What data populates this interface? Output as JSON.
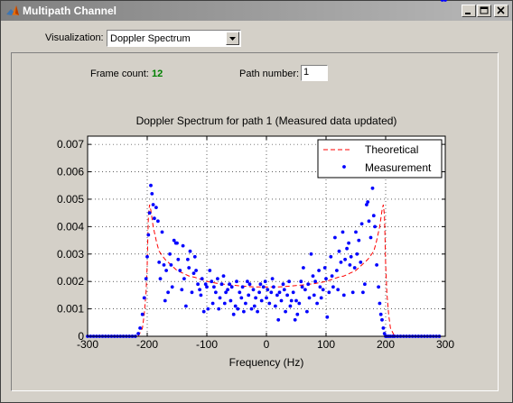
{
  "window": {
    "title": "Multipath Channel",
    "buttons": [
      "minimize",
      "maximize",
      "close"
    ]
  },
  "controls": {
    "visualization_label": "Visualization:",
    "visualization_value": "Doppler Spectrum",
    "frame_count_label": "Frame count:",
    "frame_count_value": "12",
    "path_number_label": "Path number:",
    "path_number_value": "1"
  },
  "colors": {
    "theoretical": "#ff0000",
    "measurement": "#0000ff",
    "frame_count": "#008000"
  },
  "chart_data": {
    "type": "scatter",
    "title": "Doppler Spectrum for path 1 (Measured data updated)",
    "xlabel": "Frequency (Hz)",
    "ylabel": "",
    "xlim": [
      -300,
      300
    ],
    "ylim": [
      0,
      0.0073
    ],
    "xticks": [
      "-300",
      "-200",
      "-100",
      "0",
      "100",
      "200",
      "300"
    ],
    "yticks": [
      "0",
      "0.001",
      "0.002",
      "0.003",
      "0.004",
      "0.005",
      "0.006",
      "0.007"
    ],
    "grid": true,
    "legend_position": "top-right",
    "legend": [
      "Theoretical",
      "Measurement"
    ],
    "fd": 200,
    "theoretical": {
      "name": "Theoretical",
      "style": "dashed line",
      "x": [
        -300,
        -215,
        -208,
        -205,
        -202,
        -200,
        -199,
        -198,
        -196,
        -194,
        -192,
        -190,
        -187,
        -184,
        -180,
        -170,
        -160,
        -150,
        -140,
        -130,
        -120,
        -100,
        -80,
        -60,
        -40,
        -20,
        0,
        20,
        40,
        60,
        80,
        100,
        120,
        130,
        140,
        150,
        160,
        170,
        180,
        184,
        187,
        190,
        192,
        194,
        196,
        198,
        199,
        200,
        202,
        205,
        208,
        215,
        300
      ],
      "y": [
        0,
        0,
        0.0003,
        0.0008,
        0.0016,
        0.0026,
        0.0036,
        0.0044,
        0.0048,
        0.0046,
        0.0043,
        0.004,
        0.0037,
        0.0034,
        0.0031,
        0.0028,
        0.0026,
        0.0024,
        0.0023,
        0.0022,
        0.00215,
        0.002,
        0.00192,
        0.00187,
        0.00183,
        0.0018,
        0.0018,
        0.0018,
        0.00183,
        0.00187,
        0.00192,
        0.002,
        0.00215,
        0.0022,
        0.0023,
        0.0024,
        0.0026,
        0.0028,
        0.0031,
        0.0034,
        0.0037,
        0.004,
        0.0043,
        0.0046,
        0.0048,
        0.0044,
        0.0036,
        0.0026,
        0.0016,
        0.0008,
        0.0003,
        0,
        0
      ]
    },
    "measurement": {
      "name": "Measurement",
      "style": "dot markers",
      "x": [
        -300,
        -295,
        -290,
        -285,
        -280,
        -275,
        -270,
        -265,
        -260,
        -255,
        -250,
        -245,
        -240,
        -235,
        -230,
        -225,
        -220,
        -215,
        -212,
        -208,
        -205,
        -202,
        -200,
        -198,
        -196,
        -194,
        -192,
        -190,
        -188,
        -185,
        -182,
        -180,
        -178,
        -175,
        -172,
        -170,
        -168,
        -165,
        -162,
        -160,
        -158,
        -155,
        -152,
        -150,
        -148,
        -145,
        -142,
        -140,
        -138,
        -135,
        -132,
        -130,
        -128,
        -125,
        -122,
        -120,
        -118,
        -115,
        -112,
        -110,
        -108,
        -105,
        -102,
        -100,
        -98,
        -95,
        -92,
        -90,
        -88,
        -85,
        -82,
        -80,
        -78,
        -75,
        -72,
        -70,
        -68,
        -65,
        -62,
        -60,
        -58,
        -55,
        -52,
        -50,
        -48,
        -45,
        -42,
        -40,
        -38,
        -35,
        -32,
        -30,
        -28,
        -25,
        -22,
        -20,
        -18,
        -15,
        -12,
        -10,
        -8,
        -5,
        -2,
        0,
        2,
        5,
        8,
        10,
        12,
        15,
        18,
        20,
        22,
        25,
        28,
        30,
        32,
        35,
        38,
        40,
        42,
        45,
        48,
        50,
        52,
        55,
        58,
        60,
        62,
        65,
        68,
        70,
        72,
        75,
        78,
        80,
        82,
        85,
        88,
        90,
        92,
        95,
        98,
        100,
        102,
        105,
        108,
        110,
        112,
        115,
        118,
        120,
        122,
        125,
        128,
        130,
        132,
        135,
        138,
        140,
        142,
        145,
        148,
        150,
        152,
        155,
        158,
        160,
        162,
        165,
        168,
        170,
        172,
        175,
        178,
        180,
        182,
        185,
        188,
        190,
        192,
        194,
        196,
        198,
        200,
        202,
        205,
        208,
        212,
        215,
        220,
        225,
        230,
        235,
        240,
        245,
        250,
        255,
        260,
        265,
        270,
        275,
        280,
        285,
        290,
        295,
        300
      ],
      "y": [
        0,
        0,
        0,
        0,
        0,
        0,
        0,
        0,
        0,
        0,
        0,
        0,
        0,
        0,
        0,
        0,
        0,
        0.0001,
        0.0003,
        0.0008,
        0.0014,
        0.0021,
        0.0029,
        0.0037,
        0.0045,
        0.0055,
        0.0052,
        0.0048,
        0.0043,
        0.0047,
        0.0042,
        0.0027,
        0.0021,
        0.0038,
        0.0026,
        0.0013,
        0.0024,
        0.0016,
        0.003,
        0.0026,
        0.0018,
        0.0035,
        0.0034,
        0.0034,
        0.0028,
        0.0024,
        0.0017,
        0.0033,
        0.0021,
        0.0011,
        0.0028,
        0.0025,
        0.0031,
        0.0016,
        0.0023,
        0.0029,
        0.0024,
        0.0019,
        0.0017,
        0.0015,
        0.0021,
        0.0009,
        0.0019,
        0.0018,
        0.001,
        0.0024,
        0.002,
        0.0012,
        0.0018,
        0.0016,
        0.0021,
        0.001,
        0.0014,
        0.0019,
        0.0022,
        0.0012,
        0.0016,
        0.0017,
        0.0019,
        0.0013,
        0.0018,
        0.0008,
        0.0011,
        0.002,
        0.001,
        0.0016,
        0.0014,
        0.0018,
        0.0009,
        0.0012,
        0.002,
        0.0015,
        0.0019,
        0.001,
        0.0017,
        0.0011,
        0.0014,
        0.0009,
        0.0016,
        0.0019,
        0.0013,
        0.0018,
        0.002,
        0.0014,
        0.0017,
        0.0012,
        0.0016,
        0.0021,
        0.0018,
        0.0011,
        0.0015,
        0.0006,
        0.0016,
        0.0013,
        0.0019,
        0.0017,
        0.0009,
        0.0015,
        0.002,
        0.0011,
        0.0013,
        0.0016,
        0.0006,
        0.0013,
        0.0008,
        0.0012,
        0.002,
        0.0018,
        0.0025,
        0.0017,
        0.0009,
        0.0019,
        0.0014,
        0.003,
        0.0022,
        0.0015,
        0.002,
        0.0012,
        0.0024,
        0.0018,
        0.0014,
        0.0017,
        0.0025,
        0.0021,
        0.0007,
        0.0016,
        0.0029,
        0.0022,
        0.0018,
        0.0036,
        0.0024,
        0.0017,
        0.0031,
        0.0027,
        0.0038,
        0.0015,
        0.0028,
        0.0032,
        0.0034,
        0.0026,
        0.0029,
        0.0016,
        0.0025,
        0.0038,
        0.003,
        0.0035,
        0.0027,
        0.0041,
        0.0016,
        0.0019,
        0.0048,
        0.0049,
        0.0042,
        0.0036,
        0.0054,
        0.0044,
        0.004,
        0.0026,
        0.0018,
        0.0012,
        0.0008,
        0.0006,
        0.0003,
        0.0001,
        0,
        0,
        0,
        0,
        0,
        0,
        0,
        0,
        0,
        0,
        0,
        0,
        0,
        0,
        0,
        0,
        0,
        0,
        0,
        0,
        0
      ]
    }
  }
}
